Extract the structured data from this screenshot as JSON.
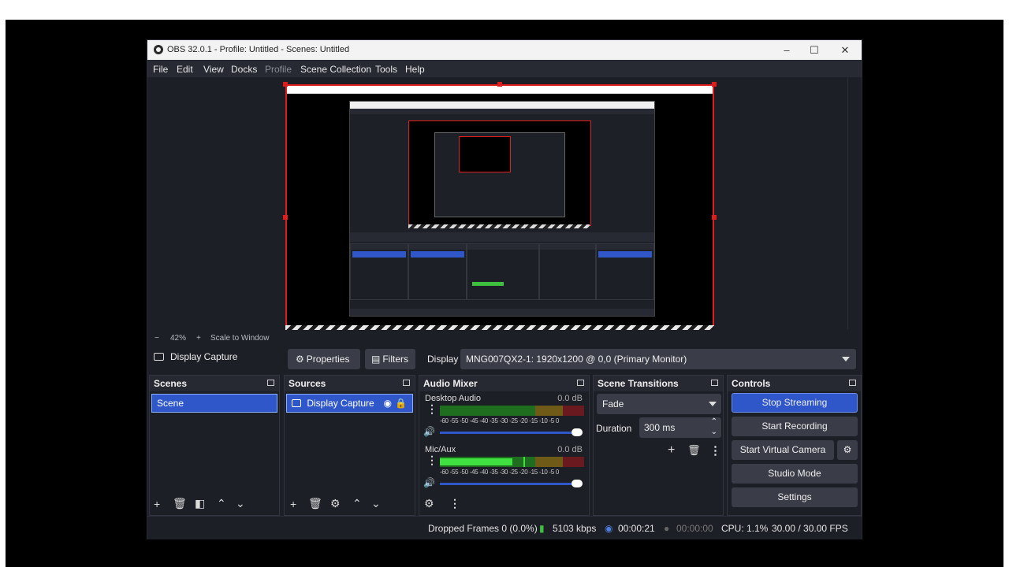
{
  "window": {
    "title": "OBS 32.0.1 - Profile: Untitled - Scenes: Untitled",
    "minimize": "–",
    "maximize": "☐",
    "close": "✕"
  },
  "menu": [
    "File",
    "Edit",
    "View",
    "Docks",
    "Profile",
    "Scene Collection",
    "Tools",
    "Help"
  ],
  "preview": {
    "zoom_out": "−",
    "zoom_level": "42%",
    "zoom_in": "+",
    "scale_mode": "Scale to Window"
  },
  "context": {
    "source_name": "Display Capture",
    "properties_label": "Properties",
    "filters_label": "Filters",
    "display_label": "Display",
    "display_value": "MNG007QX2-1: 1920x1200 @ 0,0 (Primary Monitor)"
  },
  "scenes": {
    "title": "Scenes",
    "items": [
      "Scene"
    ]
  },
  "sources": {
    "title": "Sources",
    "items": [
      "Display Capture"
    ]
  },
  "audio_mixer": {
    "title": "Audio Mixer",
    "channels": [
      {
        "name": "Desktop Audio",
        "db": "0.0 dB",
        "level": 1.0,
        "volume": 1.0
      },
      {
        "name": "Mic/Aux",
        "db": "0.0 dB",
        "level": 0.6,
        "volume": 1.0
      }
    ],
    "ticks": "-60 -55 -50 -45 -40 -35 -30 -25 -20 -15 -10 -5 0"
  },
  "transitions": {
    "title": "Scene Transitions",
    "selected": "Fade",
    "duration_label": "Duration",
    "duration_value": "300 ms"
  },
  "controls": {
    "title": "Controls",
    "stop_streaming": "Stop Streaming",
    "start_recording": "Start Recording",
    "start_virtual_camera": "Start Virtual Camera",
    "studio_mode": "Studio Mode",
    "settings": "Settings"
  },
  "status": {
    "dropped_frames": "Dropped Frames 0 (0.0%)",
    "bitrate": "5103 kbps",
    "stream_time": "00:00:21",
    "record_time": "00:00:00",
    "cpu": "CPU: 1.1%",
    "fps": "30.00 / 30.00 FPS"
  },
  "colors": {
    "accent": "#2f57c9",
    "canvas_border": "#e01c1c",
    "meter_green": "#3fbf3f",
    "meter_yellow": "#c9a227",
    "meter_red": "#c0262c"
  }
}
